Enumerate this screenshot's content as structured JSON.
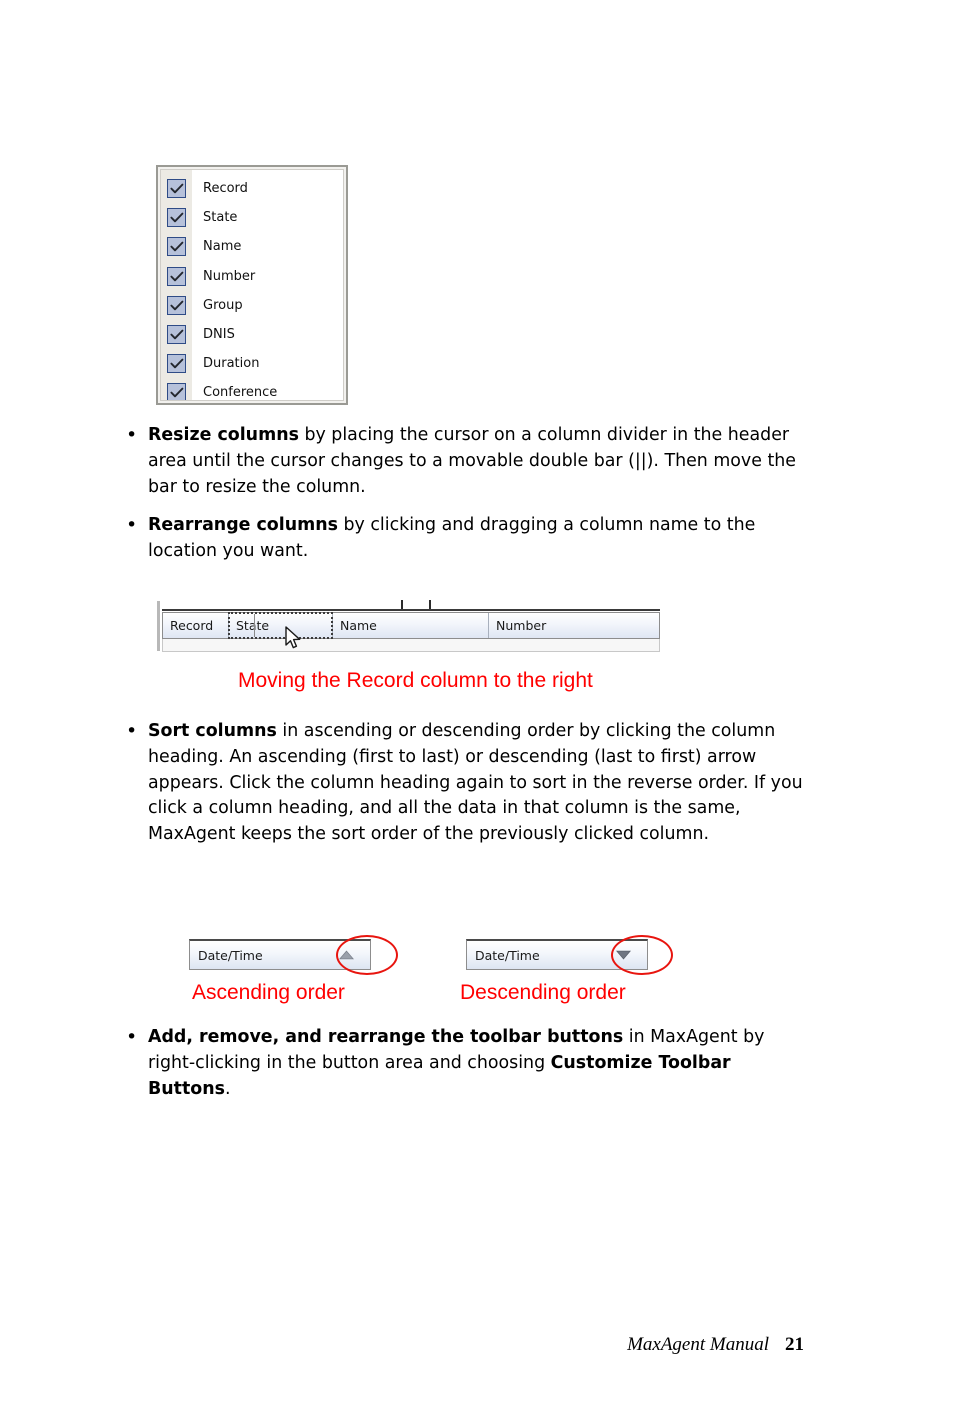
{
  "page": {
    "footer_book_title": "MaxAgent Manual",
    "footer_page_number": "21"
  },
  "column_chooser": {
    "name": "column-visibility-checkbox-list",
    "items": [
      {
        "label": "Record",
        "checked": true
      },
      {
        "label": "State",
        "checked": true
      },
      {
        "label": "Name",
        "checked": true
      },
      {
        "label": "Number",
        "checked": true
      },
      {
        "label": "Group",
        "checked": true
      },
      {
        "label": "DNIS",
        "checked": true
      },
      {
        "label": "Duration",
        "checked": true
      },
      {
        "label": "Conference",
        "checked": true
      }
    ]
  },
  "bullets": {
    "resize": {
      "lead": "Resize columns",
      "rest": " by placing the cursor on a column divider in the header area until the cursor changes to a movable double bar (||). Then move the bar to resize the column."
    },
    "rearrange": {
      "lead": "Rearrange columns",
      "rest": " by clicking and dragging a column name to the location you want."
    },
    "sort": {
      "lead": "Sort columns",
      "rest": " in ascending or descending order by clicking the column heading. An ascending (first to last) or descending (last to first) arrow appears. Click the column heading again to sort in the reverse order. If you click a column heading, and all the data in that column is the same, MaxAgent keeps the sort order of the previously clicked column."
    },
    "toolbar": {
      "lead": "Add, remove, and rearrange the toolbar buttons",
      "middle": " in MaxAgent by right-clicking in the button area and choosing ",
      "lead2": "Customize Toolbar Buttons",
      "tail": "."
    },
    "bullet_glyph": "•"
  },
  "drag_figure": {
    "columns": [
      "Record",
      "State",
      "Name",
      "Number"
    ],
    "dragged_column": "State",
    "caption": "Moving the Record column to the right"
  },
  "sort_figures": {
    "ascending": {
      "header_label": "Date/Time",
      "arrow": "ascending-arrow-up",
      "caption": "Ascending order"
    },
    "descending": {
      "header_label": "Date/Time",
      "arrow": "descending-arrow-down",
      "caption": "Descending order"
    }
  },
  "colors": {
    "annotation_red": "#ff0000",
    "ellipse_red": "#e8150f",
    "checkbox_fill": "#b6c1da",
    "checkbox_border": "#2e4b86"
  }
}
